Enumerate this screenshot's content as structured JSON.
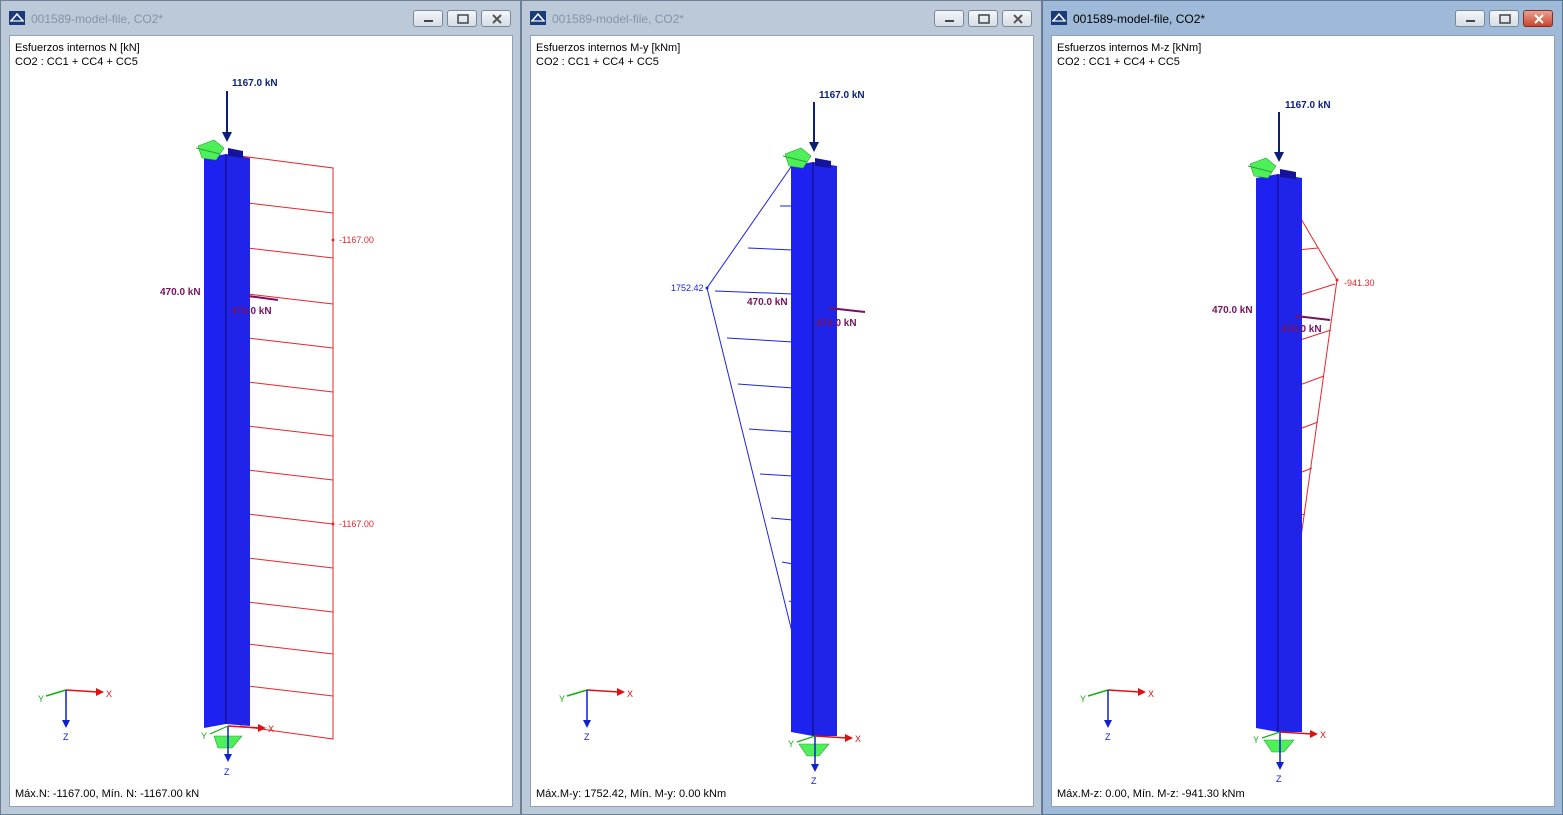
{
  "windows": [
    {
      "title": "001589-model-file, CO2*",
      "active": false,
      "header_line1": "Esfuerzos internos N [kN]",
      "header_line2": "CO2 : CC1 + CC4 + CC5",
      "footer": "Máx.N: -1167.00, Mín. N: -1167.00 kN",
      "load_top": "1167.0 kN",
      "load_side_left": "470.0 kN",
      "load_side_right": "470.0 kN",
      "diagram_labels": [
        "-1167.00",
        "-1167.00"
      ]
    },
    {
      "title": "001589-model-file, CO2*",
      "active": false,
      "header_line1": "Esfuerzos internos M-y [kNm]",
      "header_line2": "CO2 : CC1 + CC4 + CC5",
      "footer": "Máx.M-y: 1752.42, Mín. M-y: 0.00 kNm",
      "load_top": "1167.0 kN",
      "load_side_left": "470.0 kN",
      "load_side_right": "470.0 kN",
      "diagram_labels": [
        "1752.42"
      ]
    },
    {
      "title": "001589-model-file, CO2*",
      "active": true,
      "header_line1": "Esfuerzos internos M-z [kNm]",
      "header_line2": "CO2 : CC1 + CC4 + CC5",
      "footer": "Máx.M-z: 0.00, Mín. M-z: -941.30 kNm",
      "load_top": "1167.0 kN",
      "load_side_left": "470.0 kN",
      "load_side_right": "470.0 kN",
      "diagram_labels": [
        "-941.30"
      ]
    }
  ],
  "axes": {
    "x": "X",
    "y": "Y",
    "z": "Z"
  },
  "colors": {
    "member": "#1e22f0",
    "member_dark": "#141399",
    "support": "#4ef05a",
    "normal_force": "#e8262c",
    "moment_y": "#1b24e0",
    "moment_z": "#e8262c",
    "load": "#0a1f7a",
    "side_load": "#7a1060",
    "axis_x": "#e01010",
    "axis_y": "#10b010",
    "axis_z": "#1020d0"
  }
}
